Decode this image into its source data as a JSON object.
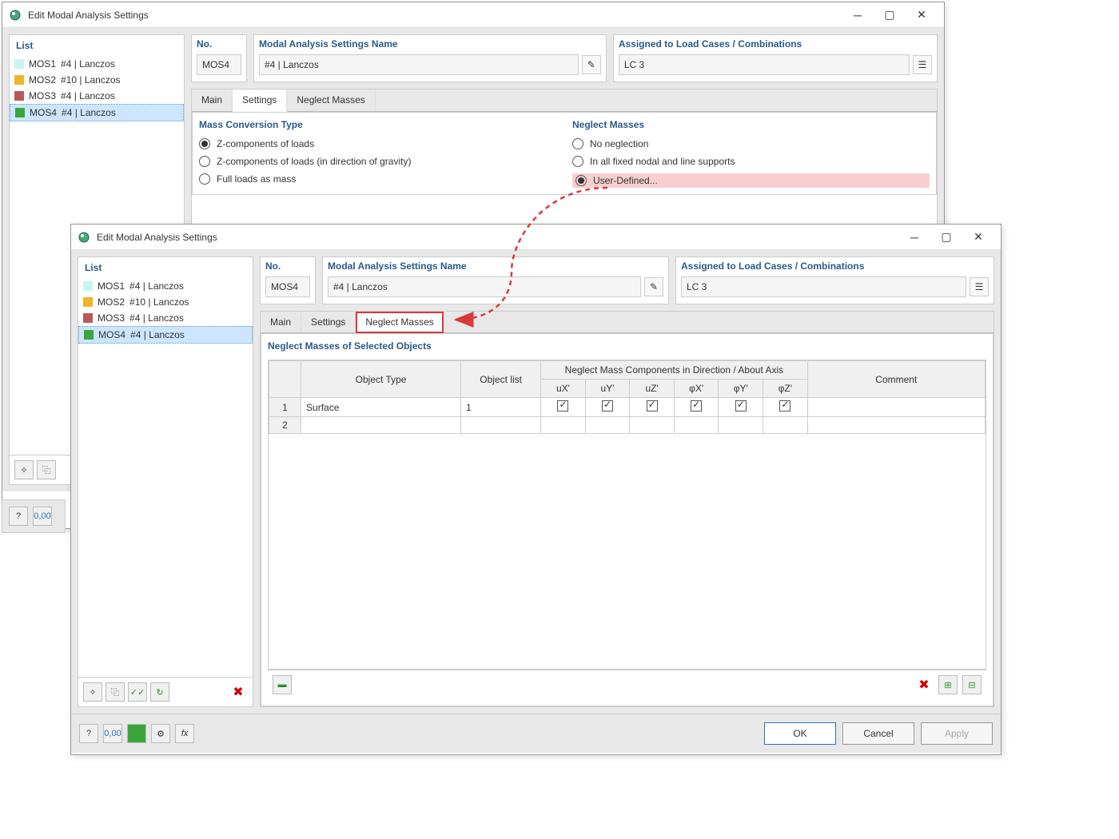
{
  "window1": {
    "title": "Edit Modal Analysis Settings",
    "list_header": "List",
    "list_items": [
      {
        "code": "MOS1",
        "label": "#4 | Lanczos",
        "color": "#c9f5f0"
      },
      {
        "code": "MOS2",
        "label": "#10 | Lanczos",
        "color": "#f2b32f"
      },
      {
        "code": "MOS3",
        "label": "#4 | Lanczos",
        "color": "#b85a5a"
      },
      {
        "code": "MOS4",
        "label": "#4 | Lanczos",
        "color": "#3aa63a"
      }
    ],
    "no_label": "No.",
    "no_value": "MOS4",
    "name_label": "Modal Analysis Settings Name",
    "name_value": "#4 | Lanczos",
    "assigned_label": "Assigned to Load Cases / Combinations",
    "assigned_value": "LC 3",
    "tabs": [
      "Main",
      "Settings",
      "Neglect Masses"
    ],
    "mass_section": "Mass Conversion Type",
    "mass_opts": [
      "Z-components of loads",
      "Z-components of loads (in direction of gravity)",
      "Full loads as mass"
    ],
    "neglect_section": "Neglect Masses",
    "neglect_opts": [
      "No neglection",
      "In all fixed nodal and line supports",
      "User-Defined..."
    ]
  },
  "window2": {
    "title": "Edit Modal Analysis Settings",
    "list_header": "List",
    "list_items": [
      {
        "code": "MOS1",
        "label": "#4 | Lanczos",
        "color": "#c9f5f0"
      },
      {
        "code": "MOS2",
        "label": "#10 | Lanczos",
        "color": "#f2b32f"
      },
      {
        "code": "MOS3",
        "label": "#4 | Lanczos",
        "color": "#b85a5a"
      },
      {
        "code": "MOS4",
        "label": "#4 | Lanczos",
        "color": "#3aa63a"
      }
    ],
    "no_label": "No.",
    "no_value": "MOS4",
    "name_label": "Modal Analysis Settings Name",
    "name_value": "#4 | Lanczos",
    "assigned_label": "Assigned to Load Cases / Combinations",
    "assigned_value": "LC 3",
    "tabs": [
      "Main",
      "Settings",
      "Neglect Masses"
    ],
    "table_section": "Neglect Masses of Selected Objects",
    "table_headers": {
      "object_type": "Object Type",
      "object_list": "Object list",
      "group": "Neglect Mass Components in Direction / About Axis",
      "cols": [
        "uX'",
        "uY'",
        "uZ'",
        "φX'",
        "φY'",
        "φZ'"
      ],
      "comment": "Comment"
    },
    "table_rows": [
      {
        "n": "1",
        "type": "Surface",
        "list": "1",
        "checks": [
          true,
          true,
          true,
          true,
          true,
          true
        ],
        "comment": ""
      },
      {
        "n": "2",
        "type": "",
        "list": "",
        "checks": [
          false,
          false,
          false,
          false,
          false,
          false
        ],
        "comment": ""
      }
    ],
    "buttons": {
      "ok": "OK",
      "cancel": "Cancel",
      "apply": "Apply"
    }
  }
}
